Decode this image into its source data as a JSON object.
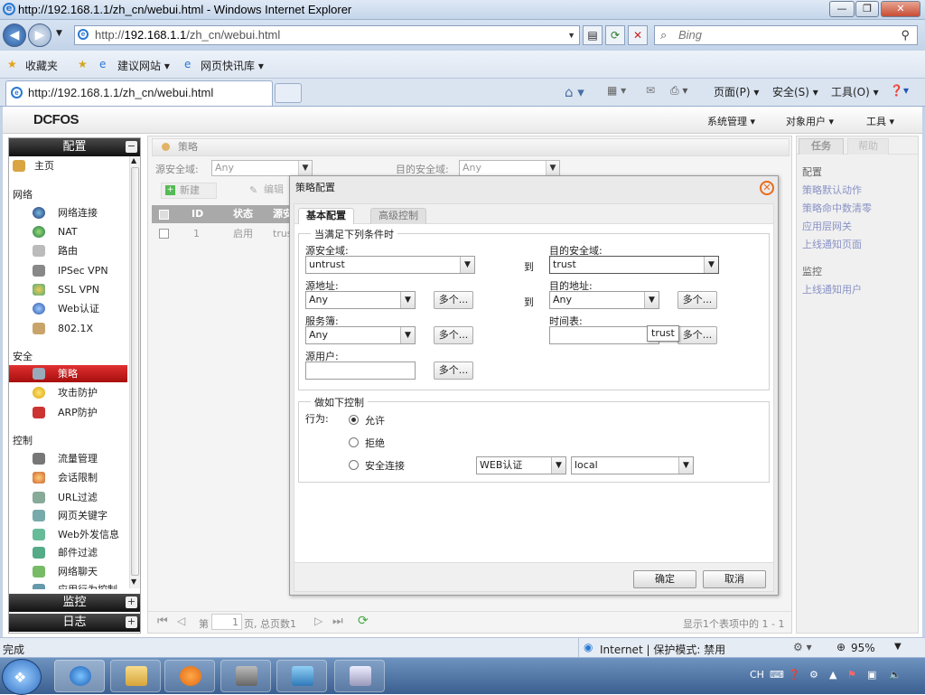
{
  "window": {
    "title": "http://192.168.1.1/zh_cn/webui.html - Windows Internet Explorer"
  },
  "address": {
    "prefix": "http://",
    "host": "192.168.1.1",
    "path": "/zh_cn/webui.html",
    "search_placeholder": "Bing"
  },
  "favorites": {
    "fav_label": "收藏夹",
    "item1": "建议网站 ▾",
    "item2": "网页快讯库 ▾"
  },
  "tab": {
    "title": "http://192.168.1.1/zh_cn/webui.html"
  },
  "commandbar": {
    "page": "页面(P) ▾",
    "safety": "安全(S) ▾",
    "tools": "工具(O) ▾"
  },
  "app": {
    "logo": "DCFOS",
    "menu": [
      "系统管理 ▾",
      "对象用户 ▾",
      "工具 ▾"
    ],
    "sidebar": {
      "config_header": "配置",
      "home": "主页",
      "sections": {
        "network": "网络",
        "security": "安全",
        "control": "控制"
      },
      "network_items": [
        "网络连接",
        "NAT",
        "路由",
        "IPSec VPN",
        "SSL VPN",
        "Web认证",
        "802.1X"
      ],
      "security_items": [
        "策略",
        "攻击防护",
        "ARP防护"
      ],
      "control_items": [
        "流量管理",
        "会话限制",
        "URL过滤",
        "网页关键字",
        "Web外发信息",
        "邮件过滤",
        "网络聊天",
        "应用行为控制"
      ],
      "monitor_header": "监控",
      "log_header": "日志"
    },
    "main": {
      "tab": "策略",
      "src_zone_label": "源安全域:",
      "src_zone_value": "Any",
      "dst_zone_label": "目的安全域:",
      "dst_zone_value": "Any",
      "new_button": "新建",
      "edit_button": "编辑",
      "table": {
        "headers": [
          "ID",
          "状态",
          "源安"
        ],
        "rows": [
          [
            "1",
            "启用",
            "trus"
          ]
        ]
      },
      "pager": {
        "page_prefix": "第",
        "page_value": "1",
        "page_suffix": "页, 总页数1",
        "summary": "显示1个表项中的 1 - 1"
      }
    },
    "right": {
      "tab_task": "任务",
      "tab_help": "帮助",
      "config_title": "配置",
      "config_links": [
        "策略默认动作",
        "策略命中数清零",
        "应用层网关",
        "上线通知页面"
      ],
      "monitor_title": "监控",
      "monitor_links": [
        "上线通知用户"
      ]
    },
    "dialog": {
      "title": "策略配置",
      "tabs": [
        "基本配置",
        "高级控制"
      ],
      "cond_legend": "当满足下列条件时",
      "src_zone_label": "源安全域:",
      "src_zone_value": "untrust",
      "to_label": "到",
      "dst_zone_label": "目的安全域:",
      "dst_zone_value": "trust",
      "src_addr_label": "源地址:",
      "src_addr_value": "Any",
      "more_label": "多个...",
      "dst_addr_label": "目的地址:",
      "dst_addr_value": "Any",
      "service_label": "服务簿:",
      "service_value": "Any",
      "schedule_label": "时间表:",
      "schedule_value": "",
      "src_user_label": "源用户:",
      "src_user_value": "",
      "tooltip": "trust",
      "action_legend": "做如下控制",
      "action_label": "行为:",
      "actions": [
        "允许",
        "拒绝",
        "安全连接"
      ],
      "selected_action": "允许",
      "auth_value": "WEB认证",
      "local_value": "local",
      "ok": "确定",
      "cancel": "取消"
    }
  },
  "statusbar": {
    "left": "完成",
    "zone": "Internet | 保护模式: 禁用",
    "zoom": "95%"
  },
  "tray": {
    "lang": "CH"
  }
}
